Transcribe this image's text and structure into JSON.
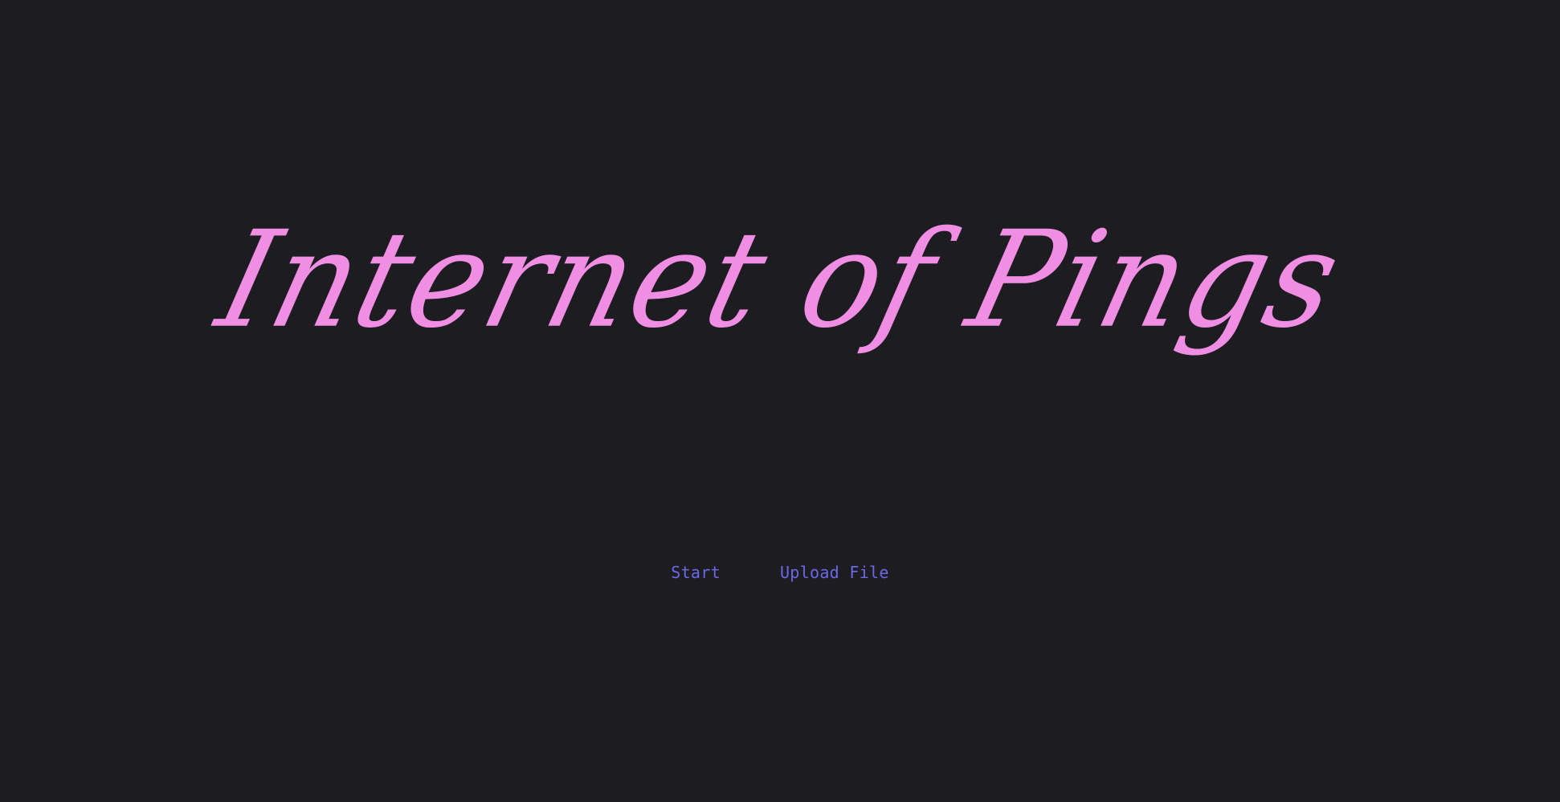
{
  "title": "Internet of Pings",
  "actions": {
    "start_label": "Start",
    "upload_label": "Upload File"
  },
  "colors": {
    "background": "#1d1c21",
    "title": "#f08ee4",
    "link": "#6b68e8"
  }
}
